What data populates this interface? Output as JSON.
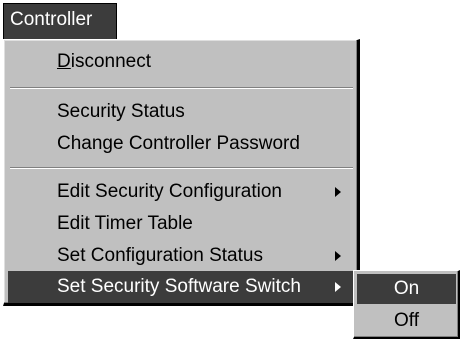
{
  "menubar": {
    "controller_label": "Controller"
  },
  "menu": {
    "disconnect": {
      "accel": "D",
      "rest": "isconnect"
    },
    "security_status": "Security Status",
    "change_password": "Change Controller Password",
    "edit_security_config": "Edit Security Configuration",
    "edit_timer_table": "Edit Timer Table",
    "set_config_status": "Set Configuration Status",
    "set_security_switch": "Set Security Software Switch"
  },
  "submenu": {
    "on": "On",
    "off": "Off"
  },
  "colors": {
    "menu_face": "#c0c0c0",
    "highlight": "#3c3c3c",
    "highlight_text": "#ffffff"
  },
  "icons": {
    "submenu_arrow": "right-triangle"
  }
}
